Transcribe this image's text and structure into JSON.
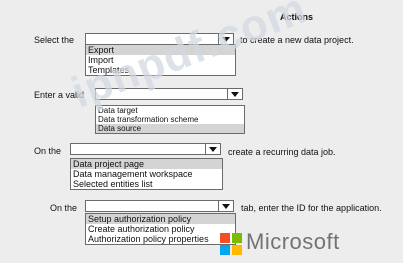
{
  "header": {
    "title": "Actions"
  },
  "q1": {
    "prefix": "Select the",
    "suffix": "to create a new data project.",
    "options": [
      "Export",
      "Import",
      "Templates"
    ]
  },
  "q2": {
    "prefix": "Enter a valid",
    "options": [
      "Data target",
      "Data transformation scheme",
      "Data source"
    ]
  },
  "q3": {
    "prefix": "On the",
    "suffix": "create a recurring data job.",
    "options": [
      "Data project page",
      "Data management workspace",
      "Selected entities list"
    ]
  },
  "q4": {
    "prefix": "On the",
    "suffix": "tab, enter the ID for the application.",
    "options": [
      "Setup authorization policy",
      "Create authorization policy",
      "Authorization policy properties"
    ]
  },
  "watermark": {
    "text": "ipnpdf.com"
  },
  "brand": {
    "text": "Microsoft",
    "colors": [
      "#f25022",
      "#7fba00",
      "#00a4ef",
      "#ffb900"
    ]
  }
}
